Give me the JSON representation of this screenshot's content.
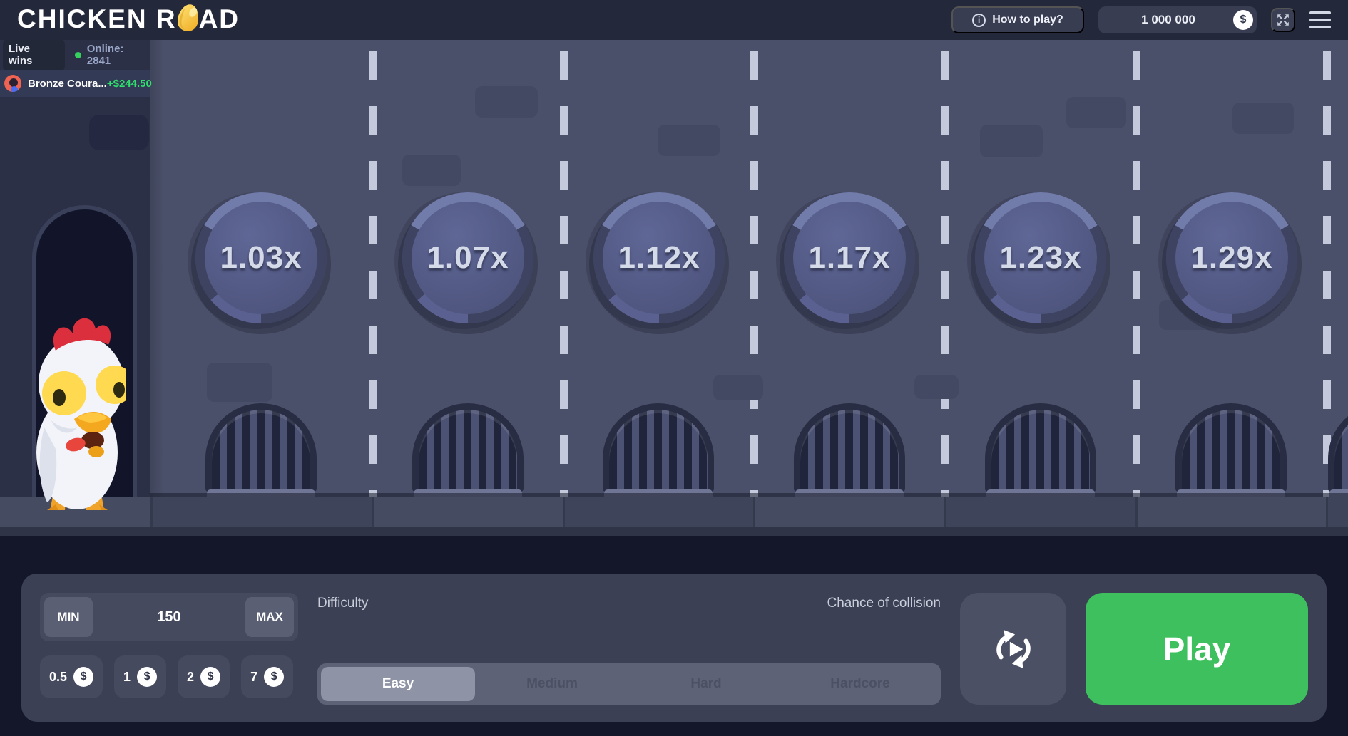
{
  "header": {
    "logo_left": "CHICKEN R",
    "logo_right": "AD",
    "egg_icon": "golden-egg-icon",
    "how_to_play_label": "How to play?",
    "balance_value": "1 000 000",
    "currency_symbol": "$",
    "fullscreen_icon": "fullscreen-expand-icon",
    "menu_icon": "hamburger-menu-icon"
  },
  "sidebar": {
    "live_wins_label": "Live wins",
    "online_label": "Online: 2841",
    "wins": [
      {
        "player": "Bronze Coura...",
        "amount": "+$244.50"
      }
    ]
  },
  "game": {
    "multipliers": [
      "1.03x",
      "1.07x",
      "1.12x",
      "1.17x",
      "1.23x",
      "1.29x"
    ]
  },
  "controls": {
    "min_label": "MIN",
    "max_label": "MAX",
    "bet_value": "150",
    "quick_bets": [
      "0.5",
      "1",
      "2",
      "7"
    ],
    "currency_symbol": "$",
    "difficulty_label": "Difficulty",
    "difficulties": [
      "Easy",
      "Medium",
      "Hard",
      "Hardcore"
    ],
    "selected_difficulty": "Easy",
    "chance_label": "Chance of collision",
    "refresh_icon": "rotate-play-icon",
    "play_label": "Play"
  },
  "colors": {
    "play_green": "#3ec05e",
    "win_green": "#2ee06c",
    "online_dot_green": "#34d15e",
    "egg_gold": "#f2b82f",
    "road": "#4b506a",
    "panel": "#3b4054"
  }
}
